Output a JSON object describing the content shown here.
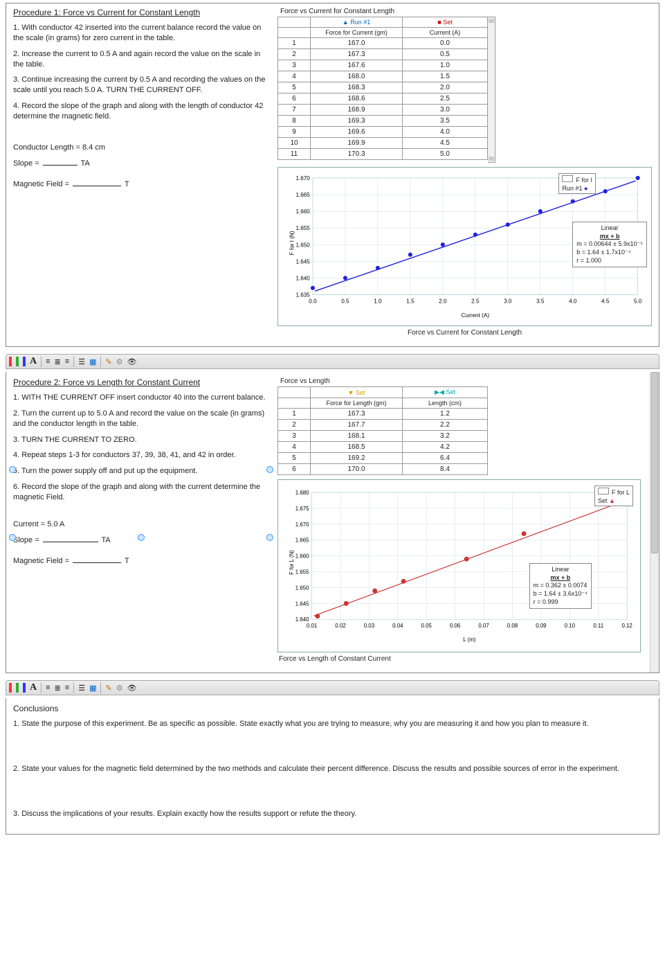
{
  "proc1": {
    "title": "Procedure 1: Force vs Current for Constant Length",
    "s1": "1. With conductor 42 inserted into the current balance record the value on the scale (in grams) for zero current in the table.",
    "s2": "2. Increase the current to 0.5 A and again record the value on the scale in the table.",
    "s3": "3. Continue increasing the current by 0.5 A and recording the values on the scale until you reach 5.0 A. TURN THE CURRENT OFF.",
    "s4": "4. Record the slope of the graph and along with the length of conductor 42 determine the magnetic field.",
    "cond": "Conductor Length = 8.4 cm",
    "slope_pre": "Slope = ",
    "slope_suf": "TA",
    "mag_pre": "Magnetic Field = ",
    "mag_suf": "T"
  },
  "tbl1": {
    "caption": "Force vs Current for Constant Length",
    "marker_a": "▲ Run #1",
    "marker_b": "■ Set",
    "ha": "Force for Current (gm)",
    "hb": "Current (A)",
    "rows": [
      [
        "1",
        "167.0",
        "0.0"
      ],
      [
        "2",
        "167.3",
        "0.5"
      ],
      [
        "3",
        "167.6",
        "1.0"
      ],
      [
        "4",
        "168.0",
        "1.5"
      ],
      [
        "5",
        "168.3",
        "2.0"
      ],
      [
        "6",
        "168.6",
        "2.5"
      ],
      [
        "7",
        "168.9",
        "3.0"
      ],
      [
        "8",
        "169.3",
        "3.5"
      ],
      [
        "9",
        "169.6",
        "4.0"
      ],
      [
        "10",
        "169.9",
        "4.5"
      ],
      [
        "11",
        "170.3",
        "5.0"
      ]
    ]
  },
  "chart1": {
    "caption": "Force vs Current for Constant Length",
    "ylabel": "F for I (N)",
    "xlabel": "Current (A)",
    "legend_title": "F for I",
    "legend_series": "Run #1",
    "fit_title": "Linear",
    "fit_eq": "mx + b",
    "fit_m": "m = 0.00644 ± 5.9x10⁻⁵",
    "fit_b": "b  = 1.64    ± 1.7x10⁻⁴",
    "fit_r": "r = 1.000",
    "yticks": [
      "1.670",
      "1.665",
      "1.660",
      "1.655",
      "1.650",
      "1.645",
      "1.640",
      "1.635"
    ],
    "xticks": [
      "0.0",
      "0.5",
      "1.0",
      "1.5",
      "2.0",
      "2.5",
      "3.0",
      "3.5",
      "4.0",
      "4.5",
      "5.0"
    ]
  },
  "chart_data": [
    {
      "type": "scatter",
      "title": "Force vs Current for Constant Length",
      "xlabel": "Current (A)",
      "ylabel": "F for I (N)",
      "xlim": [
        0.0,
        5.0
      ],
      "ylim": [
        1.635,
        1.67
      ],
      "series": [
        {
          "name": "Run #1",
          "x": [
            0.0,
            0.5,
            1.0,
            1.5,
            2.0,
            2.5,
            3.0,
            3.5,
            4.0,
            4.5,
            5.0
          ],
          "y": [
            1.637,
            1.64,
            1.643,
            1.647,
            1.65,
            1.653,
            1.656,
            1.66,
            1.663,
            1.666,
            1.67
          ]
        }
      ],
      "fit": {
        "m": 0.00644,
        "m_err": 5.9e-05,
        "b": 1.64,
        "b_err": 0.00017,
        "r": 1.0
      }
    },
    {
      "type": "scatter",
      "title": "Force vs Length of Constant Current",
      "xlabel": "L (m)",
      "ylabel": "F for L (N)",
      "xlim": [
        0.01,
        0.12
      ],
      "ylim": [
        1.64,
        1.68
      ],
      "series": [
        {
          "name": "Set",
          "x": [
            0.012,
            0.022,
            0.032,
            0.042,
            0.064,
            0.084
          ],
          "y": [
            1.641,
            1.645,
            1.649,
            1.652,
            1.659,
            1.667
          ]
        }
      ],
      "fit": {
        "m": 0.362,
        "m_err": 0.0074,
        "b": 1.64,
        "b_err": 0.00036,
        "r": 0.999
      }
    }
  ],
  "proc2": {
    "title": "Procedure 2: Force vs Length for Constant Current",
    "s1": "1. WITH THE CURRENT OFF insert conductor 40 into the current balance.",
    "s2": "2. Turn the current up to 5.0 A and record the value on the scale (in grams) and the conductor length in the table.",
    "s3": "3. TURN THE CURRENT TO ZERO.",
    "s4": "4. Repeat steps 1-3 for conductors 37, 39, 38, 41, and 42 in order.",
    "s5": "5. Turn the power supply off and put up the equipment.",
    "s6": "6. Record the slope of the graph and along with the current determine the magnetic Field.",
    "cur": "Current = 5.0 A",
    "slope_pre": "Slope = ",
    "slope_suf": "TA",
    "mag_pre": "Magnetic Field = ",
    "mag_suf": "T"
  },
  "tbl2": {
    "caption": "Force vs Length",
    "marker_a": "▼ Set",
    "marker_b": "▶◀ Set",
    "ha": "Force for Length (gm)",
    "hb": "Length (cm)",
    "rows": [
      [
        "1",
        "167.3",
        "1.2"
      ],
      [
        "2",
        "167.7",
        "2.2"
      ],
      [
        "3",
        "168.1",
        "3.2"
      ],
      [
        "4",
        "168.5",
        "4.2"
      ],
      [
        "5",
        "169.2",
        "6.4"
      ],
      [
        "6",
        "170.0",
        "8.4"
      ]
    ]
  },
  "chart2": {
    "caption": "Force vs Length of Constant Current",
    "ylabel": "F for L (N)",
    "xlabel": "L (m)",
    "legend_title": "F for L",
    "legend_series": "Set",
    "fit_title": "Linear",
    "fit_eq": "mx + b",
    "fit_m": "m = 0.362 ± 0.0074",
    "fit_b": "b  = 1.64  ± 3.6x10⁻⁴",
    "fit_r": "r = 0.999",
    "yticks": [
      "1.680",
      "1.675",
      "1.670",
      "1.665",
      "1.660",
      "1.655",
      "1.650",
      "1.645",
      "1.640"
    ],
    "xticks": [
      "0.01",
      "0.02",
      "0.03",
      "0.04",
      "0.05",
      "0.06",
      "0.07",
      "0.08",
      "0.09",
      "0.10",
      "0.11",
      "0.12"
    ]
  },
  "conc": {
    "title": "Conclusions",
    "q1": "1. State the purpose of this experiment.  Be as specific as possible.  State exactly what you are trying to measure, why you are measuring it and how you plan to measure it.",
    "q2": "2. State your values for the magnetic field determined by the two methods and calculate their percent difference.  Discuss the results and possible sources of error in the experiment.",
    "q3": "3. Discuss the implications of your results.  Explain exactly how the results support or refute the theory."
  }
}
